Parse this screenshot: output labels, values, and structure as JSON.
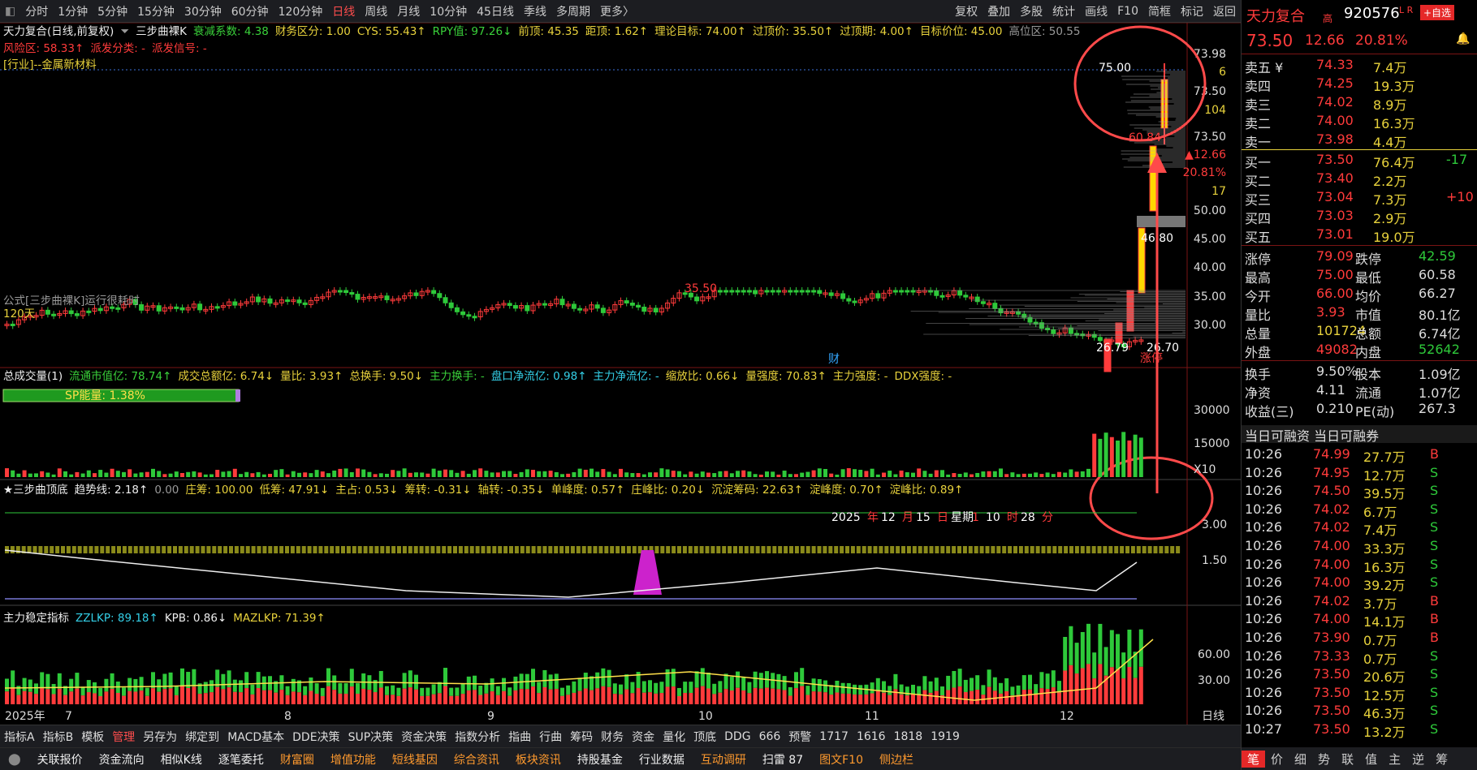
{
  "toolbar": {
    "items": [
      "分时",
      "1分钟",
      "5分钟",
      "15分钟",
      "30分钟",
      "60分钟",
      "120分钟",
      "日线",
      "周线",
      "月线",
      "10分钟",
      "45日线",
      "季线",
      "多周期",
      "更多〉"
    ],
    "right": [
      "复权",
      "叠加",
      "多股",
      "统计",
      "画线",
      "F10",
      "简框",
      "标记",
      "返回"
    ]
  },
  "chart": {
    "title": "天力复合(日线,前复权)",
    "formula": "三步曲裸K",
    "line1": [
      {
        "t": "衰减系数: 4.38",
        "c": "grn"
      },
      {
        "t": "财务区分: 1.00",
        "c": "yel"
      },
      {
        "t": "CYS: 55.43↑",
        "c": "yel"
      },
      {
        "t": "RPY值: 97.26↓",
        "c": "grn"
      },
      {
        "t": "前顶: 45.35",
        "c": "yel"
      },
      {
        "t": "距顶: 1.62↑",
        "c": "yel"
      },
      {
        "t": "理论目标: 74.00↑",
        "c": "yel"
      },
      {
        "t": "过顶价: 35.50↑",
        "c": "yel"
      },
      {
        "t": "过顶期: 4.00↑",
        "c": "yel"
      },
      {
        "t": "目标价位: 45.00",
        "c": "yel"
      },
      {
        "t": "高位区: 50.55",
        "c": "gry"
      }
    ],
    "line2": [
      {
        "t": "风险区: 58.33↑",
        "c": "red"
      },
      {
        "t": "派发分类: -",
        "c": "red"
      },
      {
        "t": "派发信号: -",
        "c": "red"
      }
    ],
    "industry": "[行业]--金属新材料",
    "runtime": "公式[三步曲裸K]运行很耗时",
    "days": "120天",
    "marker_cai": "财",
    "peak_label": "35.50",
    "price_ticks": [
      "73.98",
      "6",
      "73.50",
      "104",
      "73.50",
      "▲12.66",
      "20.81%",
      "17",
      "50.00",
      "45.00",
      "40.00",
      "35.00",
      "30.00"
    ],
    "high_label": "75.00",
    "low_box": "60.84",
    "mid_box": "46.80",
    "left_low": "26.79",
    "right_low": "26.70",
    "zhangting": "涨停",
    "vol": {
      "title": "总成交量(1)",
      "items": [
        {
          "t": "流通市值亿: 78.74↑",
          "c": "grn"
        },
        {
          "t": "成交总额亿: 6.74↓",
          "c": "yel"
        },
        {
          "t": "量比: 3.93↑",
          "c": "yel"
        },
        {
          "t": "总换手: 9.50↓",
          "c": "yel"
        },
        {
          "t": "主力换手: -",
          "c": "grn"
        },
        {
          "t": "盘口净流亿: 0.98↑",
          "c": "cyn"
        },
        {
          "t": "主力净流亿: -",
          "c": "cyn"
        },
        {
          "t": "缩放比: 0.66↓",
          "c": "yel"
        },
        {
          "t": "量强度: 70.83↑",
          "c": "yel"
        },
        {
          "t": "主力强度: -",
          "c": "yel"
        },
        {
          "t": "DDX强度: -",
          "c": "yel"
        }
      ],
      "sp": "SP能量:  1.38%",
      "ticks": [
        "30000",
        "15000",
        "X10"
      ]
    },
    "step": {
      "title": "★三步曲顶底",
      "items": [
        {
          "t": "趋势线: 2.18↑",
          "c": "wht"
        },
        {
          "t": "0.00",
          "c": "gry"
        },
        {
          "t": "庄筹: 100.00",
          "c": "yel"
        },
        {
          "t": "低筹: 47.91↓",
          "c": "yel"
        },
        {
          "t": "主占: 0.53↓",
          "c": "yel"
        },
        {
          "t": "筹转: -0.31↓",
          "c": "yel"
        },
        {
          "t": "轴转: -0.35↓",
          "c": "yel"
        },
        {
          "t": "单峰度: 0.57↑",
          "c": "yel"
        },
        {
          "t": "庄峰比: 0.20↓",
          "c": "yel"
        },
        {
          "t": "沉淀筹码: 22.63↑",
          "c": "yel"
        },
        {
          "t": "淀峰度: 0.70↑",
          "c": "yel"
        },
        {
          "t": "淀峰比: 0.89↑",
          "c": "yel"
        }
      ],
      "date": [
        "2025",
        "年",
        "12",
        "月",
        "15",
        "日",
        "星期",
        "1",
        "10",
        "时",
        "28",
        "分"
      ],
      "ticks": [
        "3.00",
        "1.50"
      ]
    },
    "zl": {
      "title": "主力稳定指标",
      "items": [
        {
          "t": "ZZLKP: 89.18↑",
          "c": "cyn"
        },
        {
          "t": "KPB: 0.86↓",
          "c": "wht"
        },
        {
          "t": "MAZLKP: 71.39↑",
          "c": "yel"
        }
      ],
      "ticks": [
        "60.00",
        "30.00"
      ]
    },
    "xaxis": [
      "2025年",
      "7",
      "8",
      "9",
      "10",
      "11",
      "12"
    ],
    "period": "日线"
  },
  "bottom1": [
    "指标A",
    "指标B",
    "模板",
    "管理",
    "另存为",
    "绑定到",
    "MACD基本",
    "DDE决策",
    "SUP决策",
    "资金决策",
    "指数分析",
    "指曲",
    "行曲",
    "筹码",
    "财务",
    "资金",
    "量化",
    "顶底",
    "DDG",
    "666",
    "预警",
    "1717",
    "1616",
    "1818",
    "1919"
  ],
  "bottom2": [
    {
      "t": "关联报价",
      "c": "wht"
    },
    {
      "t": "资金流向",
      "c": "wht"
    },
    {
      "t": "相似K线",
      "c": "wht"
    },
    {
      "t": "逐笔委托",
      "c": "wht"
    },
    {
      "t": "财富圈",
      "c": "org"
    },
    {
      "t": "增值功能",
      "c": "org"
    },
    {
      "t": "短线基因",
      "c": "org"
    },
    {
      "t": "综合资讯",
      "c": "org"
    },
    {
      "t": "板块资讯",
      "c": "org"
    },
    {
      "t": "持股基金",
      "c": "wht"
    },
    {
      "t": "行业数据",
      "c": "wht"
    },
    {
      "t": "互动调研",
      "c": "org"
    },
    {
      "t": "扫雷 87",
      "c": "wht"
    },
    {
      "t": "图文F10",
      "c": "org"
    },
    {
      "t": "侧边栏",
      "c": "org"
    }
  ],
  "side": {
    "name": "天力复合",
    "tag": "高",
    "code": "920576",
    "tag2": "L R",
    "add": "+自选",
    "price": "73.50",
    "chg": "12.66",
    "pct": "20.81%",
    "asks": [
      [
        "卖五 ¥",
        "74.33",
        "7.4万"
      ],
      [
        "卖四",
        "74.25",
        "19.3万"
      ],
      [
        "卖三",
        "74.02",
        "8.9万"
      ],
      [
        "卖二",
        "74.00",
        "16.3万"
      ],
      [
        "卖一",
        "73.98",
        "4.4万"
      ]
    ],
    "bids": [
      [
        "买一",
        "73.50",
        "76.4万",
        "-17"
      ],
      [
        "买二",
        "73.40",
        "2.2万",
        ""
      ],
      [
        "买三",
        "73.04",
        "7.3万",
        "+10"
      ],
      [
        "买四",
        "73.03",
        "2.9万",
        ""
      ],
      [
        "买五",
        "73.01",
        "19.0万",
        ""
      ]
    ],
    "stats1": [
      [
        "涨停",
        "79.09",
        "跌停",
        "42.59"
      ],
      [
        "最高",
        "75.00",
        "最低",
        "60.58"
      ],
      [
        "今开",
        "66.00",
        "均价",
        "66.27"
      ],
      [
        "量比",
        "3.93",
        "市值",
        "80.1亿"
      ],
      [
        "总量",
        "101724",
        "总额",
        "6.74亿"
      ],
      [
        "外盘",
        "49082",
        "内盘",
        "52642"
      ]
    ],
    "stats2": [
      [
        "换手",
        "9.50%",
        "股本",
        "1.09亿"
      ],
      [
        "净资",
        "4.11",
        "流通",
        "1.07亿"
      ],
      [
        "收益(三)",
        "0.210",
        "PE(动)",
        "267.3"
      ]
    ],
    "margin": "当日可融资 当日可融券",
    "ticks": [
      [
        "10:26",
        "74.99",
        "27.7万",
        "B"
      ],
      [
        "10:26",
        "74.95",
        "12.7万",
        "S"
      ],
      [
        "10:26",
        "74.50",
        "39.5万",
        "S"
      ],
      [
        "10:26",
        "74.02",
        "6.7万",
        "S"
      ],
      [
        "10:26",
        "74.02",
        "7.4万",
        "S"
      ],
      [
        "10:26",
        "74.00",
        "33.3万",
        "S"
      ],
      [
        "10:26",
        "74.00",
        "16.3万",
        "S"
      ],
      [
        "10:26",
        "74.00",
        "39.2万",
        "S"
      ],
      [
        "10:26",
        "74.02",
        "3.7万",
        "B"
      ],
      [
        "10:26",
        "74.00",
        "14.1万",
        "B"
      ],
      [
        "10:26",
        "73.90",
        "0.7万",
        "B"
      ],
      [
        "10:26",
        "73.33",
        "0.7万",
        "S"
      ],
      [
        "10:26",
        "73.50",
        "20.6万",
        "S"
      ],
      [
        "10:26",
        "73.50",
        "12.5万",
        "S"
      ],
      [
        "10:26",
        "73.50",
        "46.3万",
        "S"
      ],
      [
        "10:27",
        "73.50",
        "13.2万",
        "S"
      ]
    ],
    "tabs": [
      "笔",
      "价",
      "细",
      "势",
      "联",
      "值",
      "主",
      "逆",
      "筹"
    ]
  }
}
